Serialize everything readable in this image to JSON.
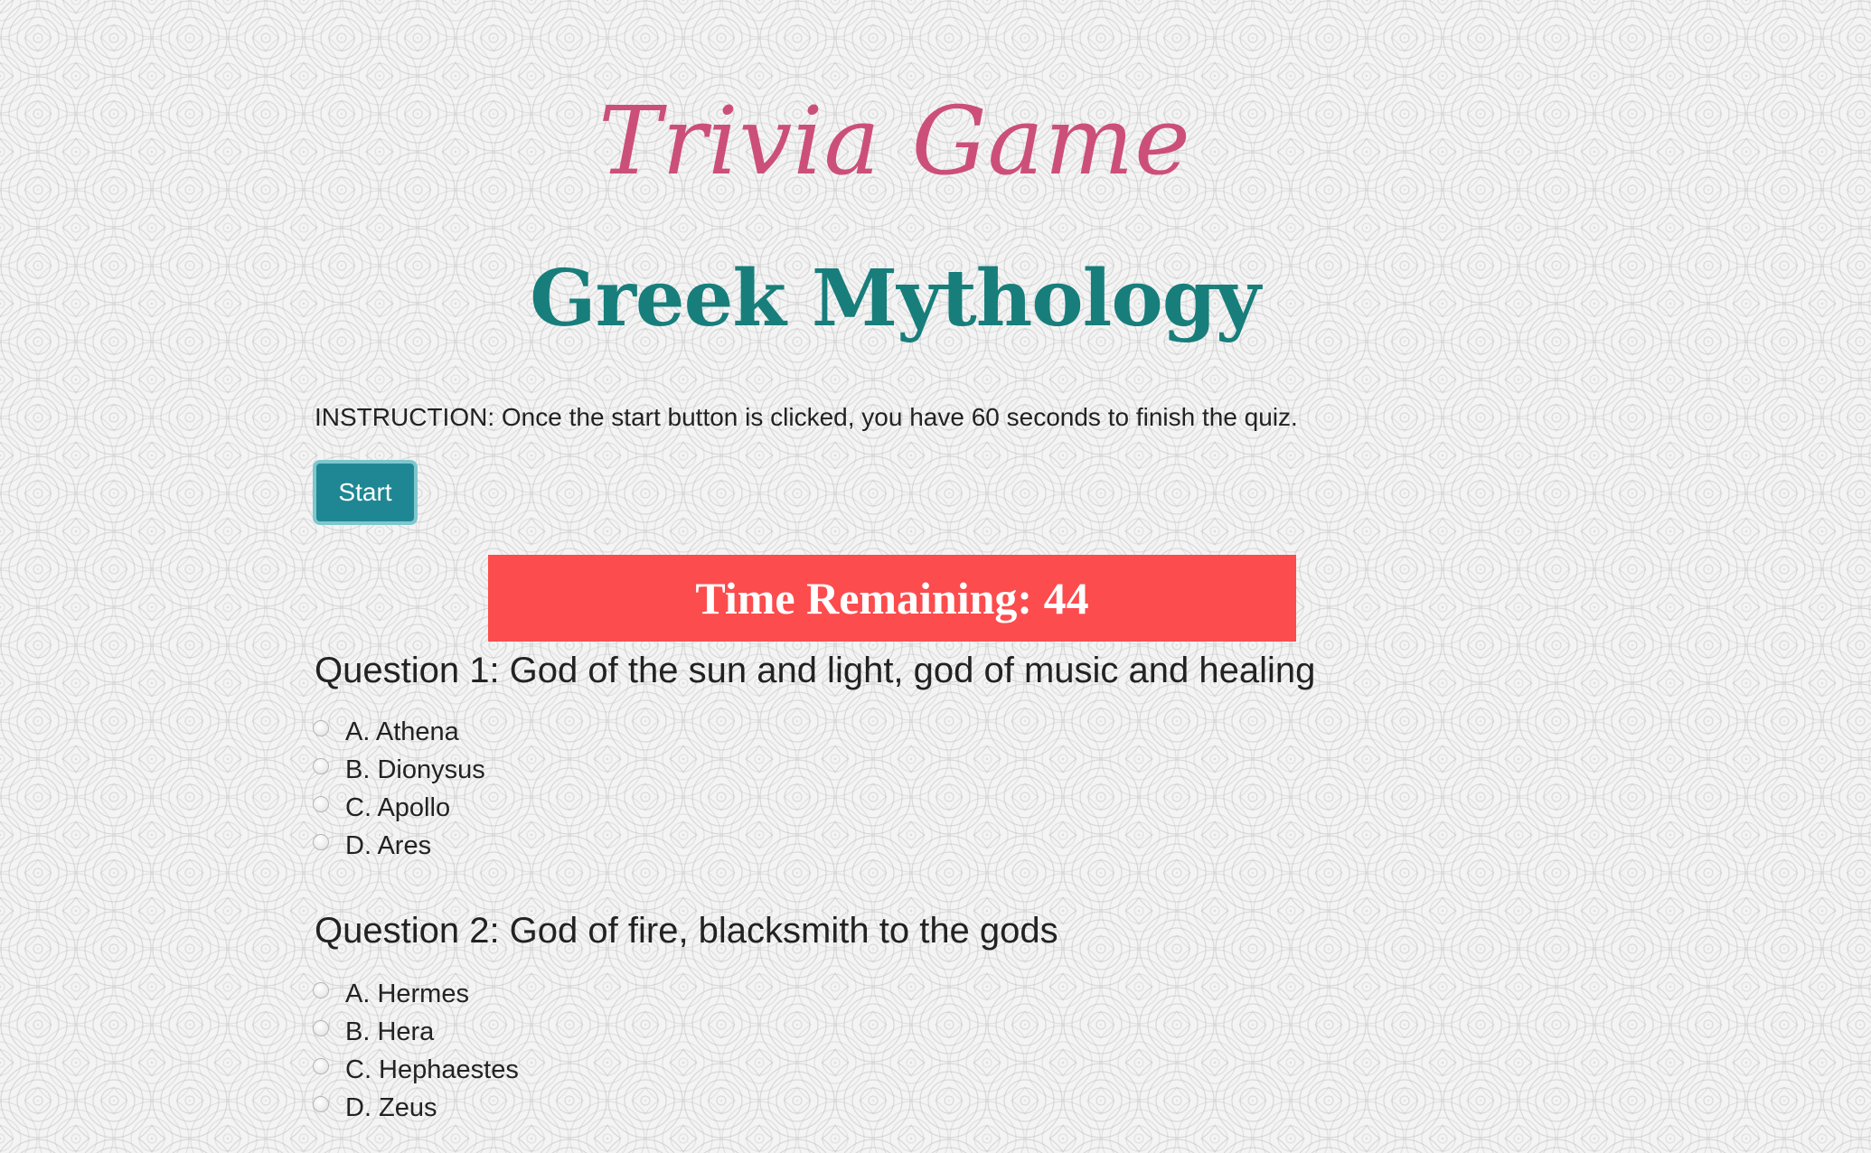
{
  "header": {
    "title": "Trivia Game",
    "subtitle": "Greek Mythology"
  },
  "instruction": "INSTRUCTION: Once the start button is clicked, you have 60 seconds to finish the quiz.",
  "start_button": {
    "label": "Start"
  },
  "timer": {
    "label": "Time Remaining: ",
    "value": "44"
  },
  "questions": [
    {
      "text": "Question 1: God of the sun and light, god of music and healing",
      "options": [
        "A. Athena",
        "B. Dionysus",
        "C. Apollo",
        "D. Ares"
      ]
    },
    {
      "text": "Question 2: God of fire, blacksmith to the gods",
      "options": [
        "A. Hermes",
        "B. Hera",
        "C. Hephaestes",
        "D. Zeus"
      ]
    }
  ],
  "colors": {
    "title": "#cc4f7a",
    "subtitle": "#177e7b",
    "start_button": "#1f8793",
    "timer_background": "#fc4c4e"
  }
}
